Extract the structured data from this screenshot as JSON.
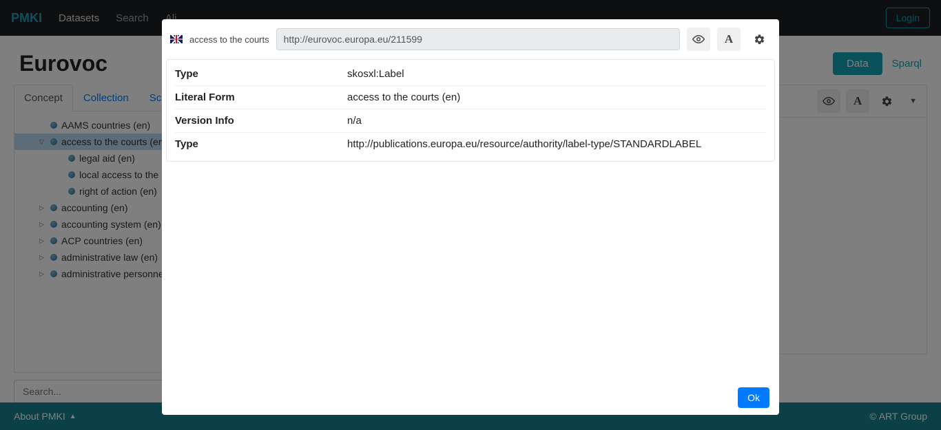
{
  "navbar": {
    "brand": "PMKI",
    "links": [
      "Datasets",
      "Search",
      "Ali"
    ],
    "login": "Login"
  },
  "header": {
    "title": "Eurovoc",
    "data_btn": "Data",
    "sparql_btn": "Sparql"
  },
  "tabs": {
    "concept": "Concept",
    "collection": "Collection",
    "scheme": "Scheme"
  },
  "tree": {
    "items": [
      {
        "label": "AAMS countries (en)",
        "level": 1,
        "expandable": false,
        "selected": false
      },
      {
        "label": "access to the courts (en)",
        "level": 1,
        "expandable": true,
        "expanded": true,
        "selected": true
      },
      {
        "label": "legal aid (en)",
        "level": 2,
        "expandable": false,
        "selected": false
      },
      {
        "label": "local access to the law (en)",
        "level": 2,
        "expandable": false,
        "selected": false
      },
      {
        "label": "right of action (en)",
        "level": 2,
        "expandable": false,
        "selected": false
      },
      {
        "label": "accounting (en)",
        "level": 1,
        "expandable": true,
        "expanded": false,
        "selected": false
      },
      {
        "label": "accounting system (en)",
        "level": 1,
        "expandable": true,
        "expanded": false,
        "selected": false
      },
      {
        "label": "ACP countries (en)",
        "level": 1,
        "expandable": true,
        "expanded": false,
        "selected": false
      },
      {
        "label": "administrative law (en)",
        "level": 1,
        "expandable": true,
        "expanded": false,
        "selected": false
      },
      {
        "label": "administrative personnel (en)",
        "level": 1,
        "expandable": true,
        "expanded": false,
        "selected": false
      }
    ]
  },
  "search": {
    "placeholder": "Search..."
  },
  "modal": {
    "resource_label": "access to the courts",
    "uri": "http://eurovoc.europa.eu/211599",
    "props": [
      {
        "key": "Type",
        "value": "skosxl:Label"
      },
      {
        "key": "Literal Form",
        "value": "access to the courts  (en)"
      },
      {
        "key": "Version Info",
        "value": "n/a"
      },
      {
        "key": "Type",
        "value": "http://publications.europa.eu/resource/authority/label-type/STANDARDLABEL"
      }
    ],
    "ok": "Ok"
  },
  "footer": {
    "about": "About PMKI",
    "copyright": "© ART Group"
  }
}
